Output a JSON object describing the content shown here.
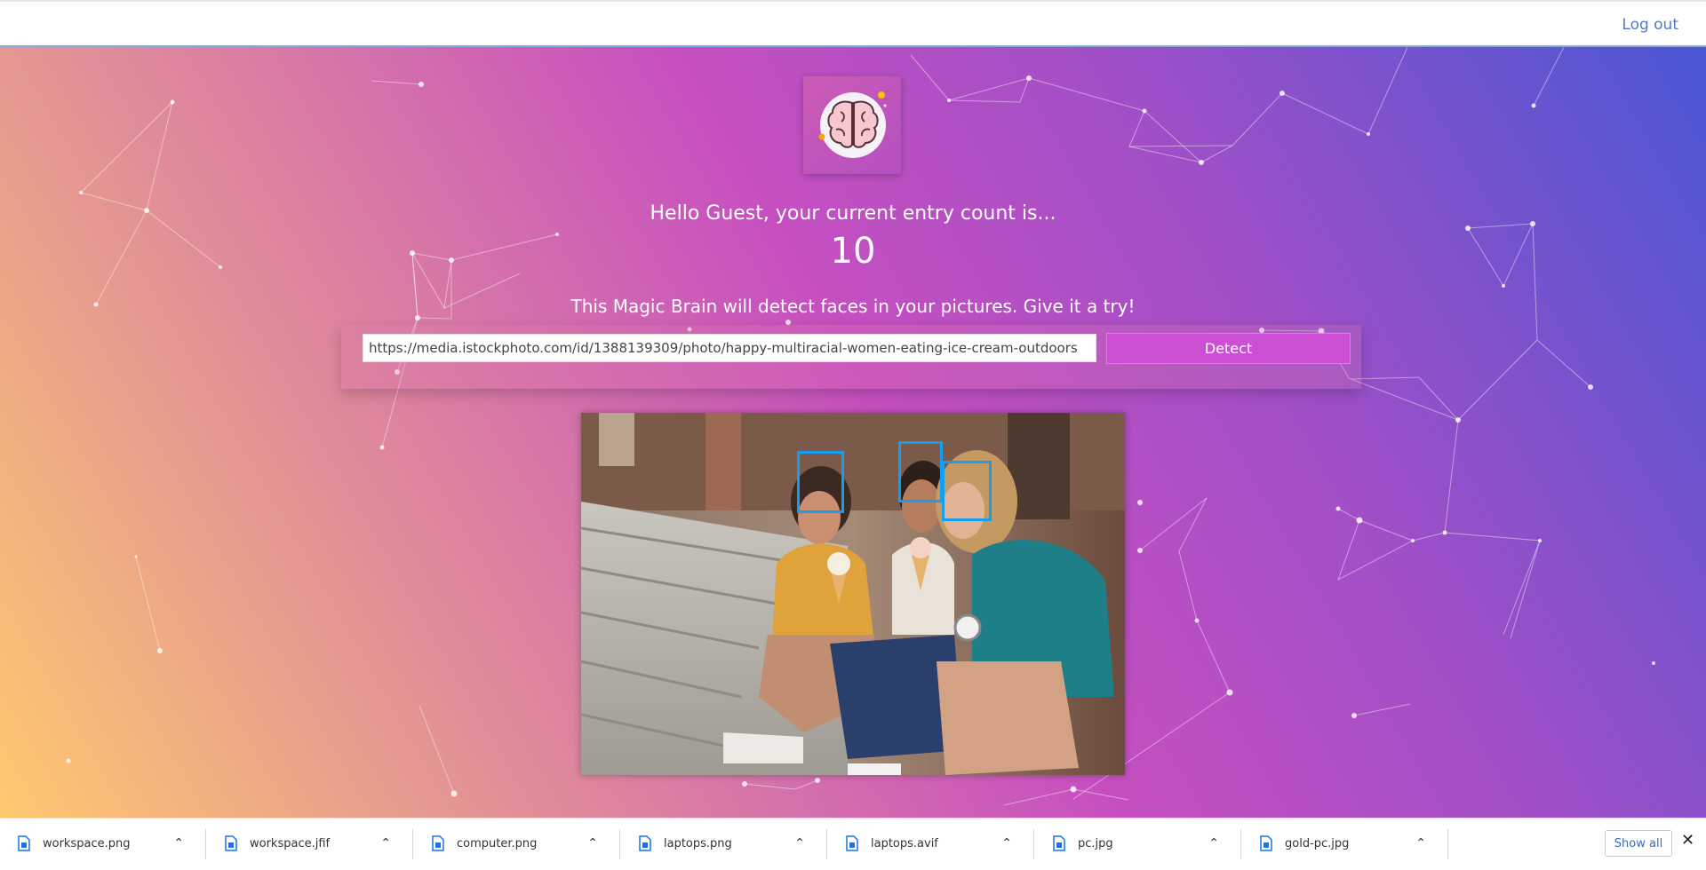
{
  "nav": {
    "logout_label": "Log out"
  },
  "logo": {
    "icon": "brain-icon"
  },
  "greeting": "Hello Guest, your current entry count is...",
  "entry_count": "10",
  "tagline": "This Magic Brain will detect faces in your pictures. Give it a try!",
  "form": {
    "url_value": "https://media.istockphoto.com/id/1388139309/photo/happy-multiracial-women-eating-ice-cream-outdoors",
    "detect_label": "Detect"
  },
  "result": {
    "faces_detected": 3,
    "box_color": "#149df2"
  },
  "downloads": {
    "items": [
      {
        "name": "workspace.png",
        "icon": "file-icon"
      },
      {
        "name": "workspace.jfif",
        "icon": "file-icon"
      },
      {
        "name": "computer.png",
        "icon": "file-icon"
      },
      {
        "name": "laptops.png",
        "icon": "file-icon"
      },
      {
        "name": "laptops.avif",
        "icon": "file-icon"
      },
      {
        "name": "pc.jpg",
        "icon": "file-icon"
      },
      {
        "name": "gold-pc.jpg",
        "icon": "file-icon"
      }
    ],
    "show_all_label": "Show all",
    "close_icon": "✕"
  },
  "colors": {
    "accent": "#cc4fd3",
    "link": "#4d79cf"
  }
}
